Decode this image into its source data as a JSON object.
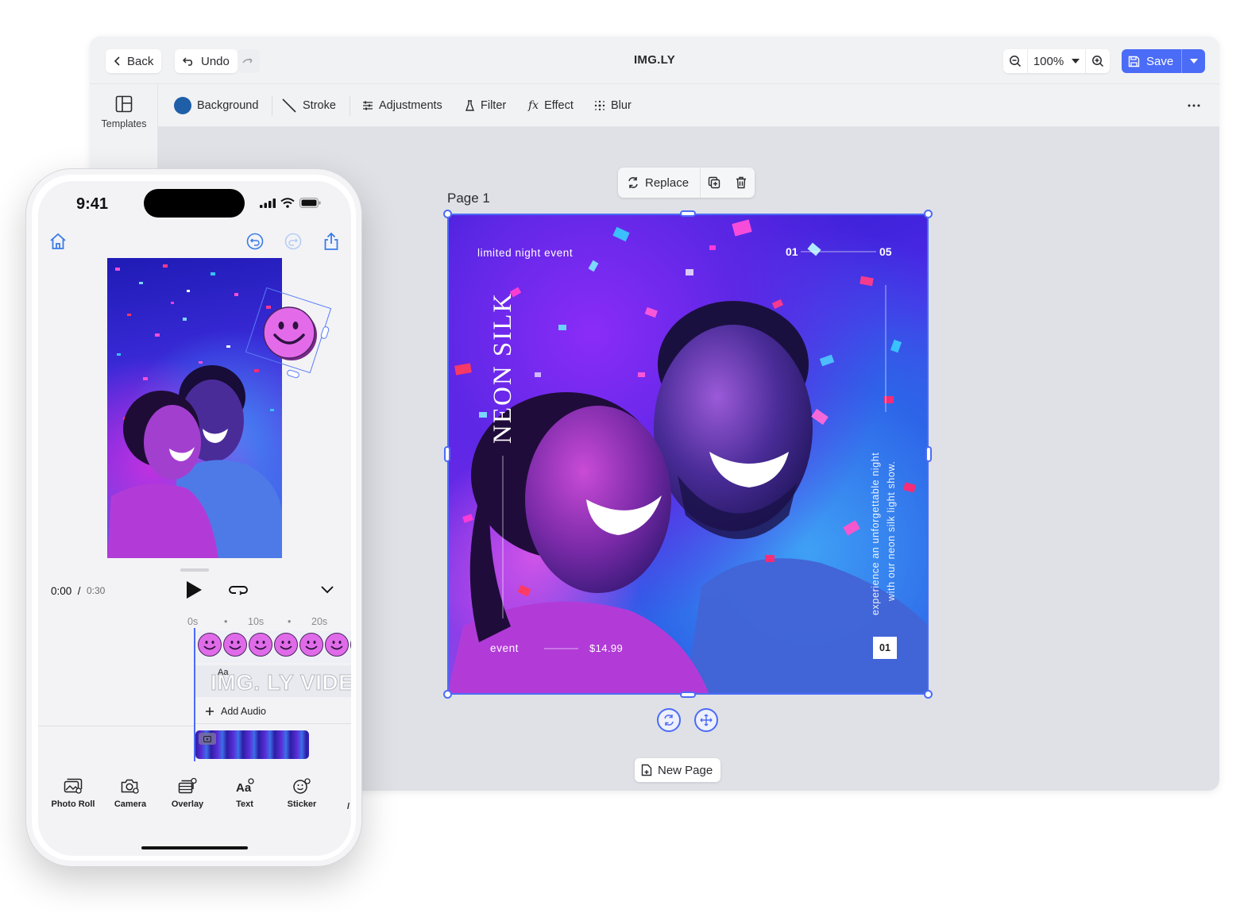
{
  "editor": {
    "title": "IMG.LY",
    "back_label": "Back",
    "undo_label": "Undo",
    "zoom": "100%",
    "save_label": "Save",
    "sidebar": {
      "templates_label": "Templates"
    },
    "toolbar": {
      "background": "Background",
      "stroke": "Stroke",
      "adjustments": "Adjustments",
      "filter": "Filter",
      "effect": "Effect",
      "blur": "Blur"
    },
    "page_label": "Page 1",
    "replace_label": "Replace",
    "new_page_label": "New Page",
    "accent_color": "#4b6cf6",
    "background_swatch": "#1f5fa8"
  },
  "poster": {
    "tagline": "limited night event",
    "counter_start": "01",
    "counter_end": "05",
    "title": "NEON SILK",
    "side_text_1": "experience an unforgettable night",
    "side_text_2": "with our neon silk light show.",
    "event_label": "event",
    "price": "$14.99",
    "page_number": "01"
  },
  "phone": {
    "status_time": "9:41",
    "current_time": "0:00",
    "separator": "/",
    "total_time": "0:30",
    "ruler": [
      "0s",
      "•",
      "10s",
      "•",
      "20s"
    ],
    "text_track_badge": "Aa",
    "text_track_content": "IMG. LY VIDEO",
    "add_audio_label": "Add Audio",
    "tabs": {
      "photo_roll": "Photo Roll",
      "camera": "Camera",
      "overlay": "Overlay",
      "text": "Text",
      "sticker": "Sticker"
    }
  }
}
